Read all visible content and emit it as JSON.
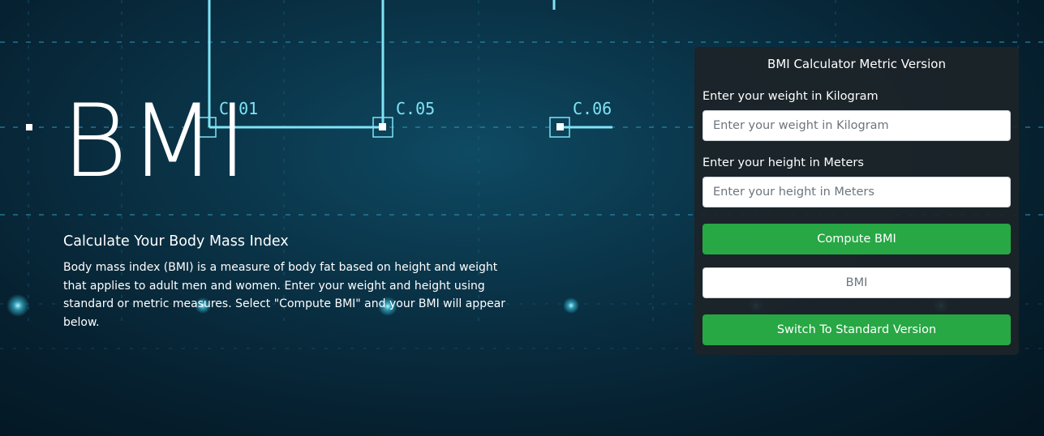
{
  "hero": {
    "title": "BMI",
    "subtitle": "Calculate Your Body Mass Index",
    "description": "Body mass index (BMI) is a measure of body fat based on height and weight that applies to adult men and women. Enter your weight and height using standard or metric measures. Select \"Compute BMI\" and your BMI will appear below."
  },
  "background": {
    "labels": [
      "C.01",
      "C.05",
      "C.06"
    ],
    "colors": {
      "base": "#06202f",
      "line": "#7fe3f5",
      "grid": "#2b8fb0"
    }
  },
  "calculator": {
    "title": "BMI Calculator Metric Version",
    "weight": {
      "label": "Enter your weight in Kilogram",
      "placeholder": "Enter your weight in Kilogram",
      "value": ""
    },
    "height": {
      "label": "Enter your height in Meters",
      "placeholder": "Enter your height in Meters",
      "value": ""
    },
    "compute_label": "Compute BMI",
    "result": {
      "placeholder": "BMI",
      "value": ""
    },
    "switch_label": "Switch To Standard Version",
    "colors": {
      "button": "#28a745",
      "card": "#1c2328"
    }
  }
}
